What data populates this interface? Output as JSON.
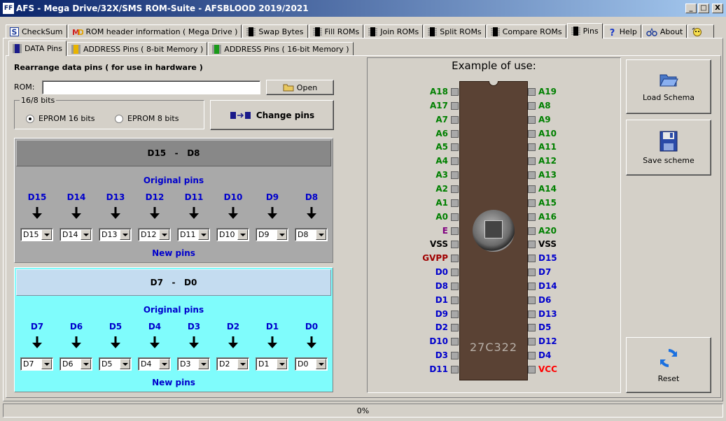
{
  "window": {
    "title": "AFS - Mega Drive/32X/SMS  ROM-Suite - AFSBLOOD  2019/2021",
    "icon_text": "FF",
    "minimize": "_",
    "maximize": "□",
    "close": "X"
  },
  "main_tabs": [
    {
      "label": "CheckSum",
      "icon": "checksum-icon"
    },
    {
      "label": "ROM header information ( Mega Drive )",
      "icon": "md-logo-icon"
    },
    {
      "label": "Swap Bytes",
      "icon": "chip-icon"
    },
    {
      "label": "Fill ROMs",
      "icon": "chip-icon"
    },
    {
      "label": "Join ROMs",
      "icon": "chip-icon"
    },
    {
      "label": "Split ROMs",
      "icon": "chip-icon"
    },
    {
      "label": "Compare ROMs",
      "icon": "chip-icon"
    },
    {
      "label": "Pins",
      "icon": "chip-icon"
    },
    {
      "label": "Help",
      "icon": "question-icon"
    },
    {
      "label": "About",
      "icon": "about-icon"
    },
    {
      "label": "",
      "icon": "face-icon"
    }
  ],
  "sub_tabs": [
    {
      "label": "DATA Pins",
      "color": "#1a1a8a"
    },
    {
      "label": "ADDRESS Pins ( 8-bit Memory )",
      "color": "#e8b400"
    },
    {
      "label": "ADDRESS Pins ( 16-bit Memory )",
      "color": "#1a9a1a"
    }
  ],
  "data_pins": {
    "heading": "Rearrange data pins ( for use in hardware )",
    "rom_label": "ROM:",
    "rom_value": "",
    "open_label": "Open",
    "group_label": "16/8 bits",
    "radio16": "EPROM 16 bits",
    "radio8": "EPROM 8 bits",
    "change_label": "Change pins",
    "high": {
      "title": "D15   -   D8",
      "original": "Original pins",
      "new": "New pins",
      "pins": [
        "D15",
        "D14",
        "D13",
        "D12",
        "D11",
        "D10",
        "D9",
        "D8"
      ],
      "selected": [
        "D15",
        "D14",
        "D13",
        "D12",
        "D11",
        "D10",
        "D9",
        "D8"
      ]
    },
    "low": {
      "title": "D7   -   D0",
      "original": "Original pins",
      "new": "New pins",
      "pins": [
        "D7",
        "D6",
        "D5",
        "D4",
        "D3",
        "D2",
        "D1",
        "D0"
      ],
      "selected": [
        "D7",
        "D6",
        "D5",
        "D4",
        "D3",
        "D2",
        "D1",
        "D0"
      ]
    }
  },
  "example": {
    "title": "Example of use:",
    "chip_label": "27C322",
    "left_pins": [
      {
        "t": "A18",
        "c": "#008000"
      },
      {
        "t": "A17",
        "c": "#008000"
      },
      {
        "t": "A7",
        "c": "#008000"
      },
      {
        "t": "A6",
        "c": "#008000"
      },
      {
        "t": "A5",
        "c": "#008000"
      },
      {
        "t": "A4",
        "c": "#008000"
      },
      {
        "t": "A3",
        "c": "#008000"
      },
      {
        "t": "A2",
        "c": "#008000"
      },
      {
        "t": "A1",
        "c": "#008000"
      },
      {
        "t": "A0",
        "c": "#008000"
      },
      {
        "t": "E",
        "c": "#800080"
      },
      {
        "t": "VSS",
        "c": "#000000"
      },
      {
        "t": "GVPP",
        "c": "#a00000"
      },
      {
        "t": "D0",
        "c": "#0000cc"
      },
      {
        "t": "D8",
        "c": "#0000cc"
      },
      {
        "t": "D1",
        "c": "#0000cc"
      },
      {
        "t": "D9",
        "c": "#0000cc"
      },
      {
        "t": "D2",
        "c": "#0000cc"
      },
      {
        "t": "D10",
        "c": "#0000cc"
      },
      {
        "t": "D3",
        "c": "#0000cc"
      },
      {
        "t": "D11",
        "c": "#0000cc"
      }
    ],
    "right_pins": [
      {
        "t": "A19",
        "c": "#008000"
      },
      {
        "t": "A8",
        "c": "#008000"
      },
      {
        "t": "A9",
        "c": "#008000"
      },
      {
        "t": "A10",
        "c": "#008000"
      },
      {
        "t": "A11",
        "c": "#008000"
      },
      {
        "t": "A12",
        "c": "#008000"
      },
      {
        "t": "A13",
        "c": "#008000"
      },
      {
        "t": "A14",
        "c": "#008000"
      },
      {
        "t": "A15",
        "c": "#008000"
      },
      {
        "t": "A16",
        "c": "#008000"
      },
      {
        "t": "A20",
        "c": "#008000"
      },
      {
        "t": "VSS",
        "c": "#000000"
      },
      {
        "t": "D15",
        "c": "#0000cc"
      },
      {
        "t": "D7",
        "c": "#0000cc"
      },
      {
        "t": "D14",
        "c": "#0000cc"
      },
      {
        "t": "D6",
        "c": "#0000cc"
      },
      {
        "t": "D13",
        "c": "#0000cc"
      },
      {
        "t": "D5",
        "c": "#0000cc"
      },
      {
        "t": "D12",
        "c": "#0000cc"
      },
      {
        "t": "D4",
        "c": "#0000cc"
      },
      {
        "t": "VCC",
        "c": "#ff0000"
      }
    ]
  },
  "side_buttons": {
    "load": "Load Schema",
    "save": "Save scheme",
    "reset": "Reset"
  },
  "status": {
    "progress_text": "0%",
    "progress": 0
  }
}
